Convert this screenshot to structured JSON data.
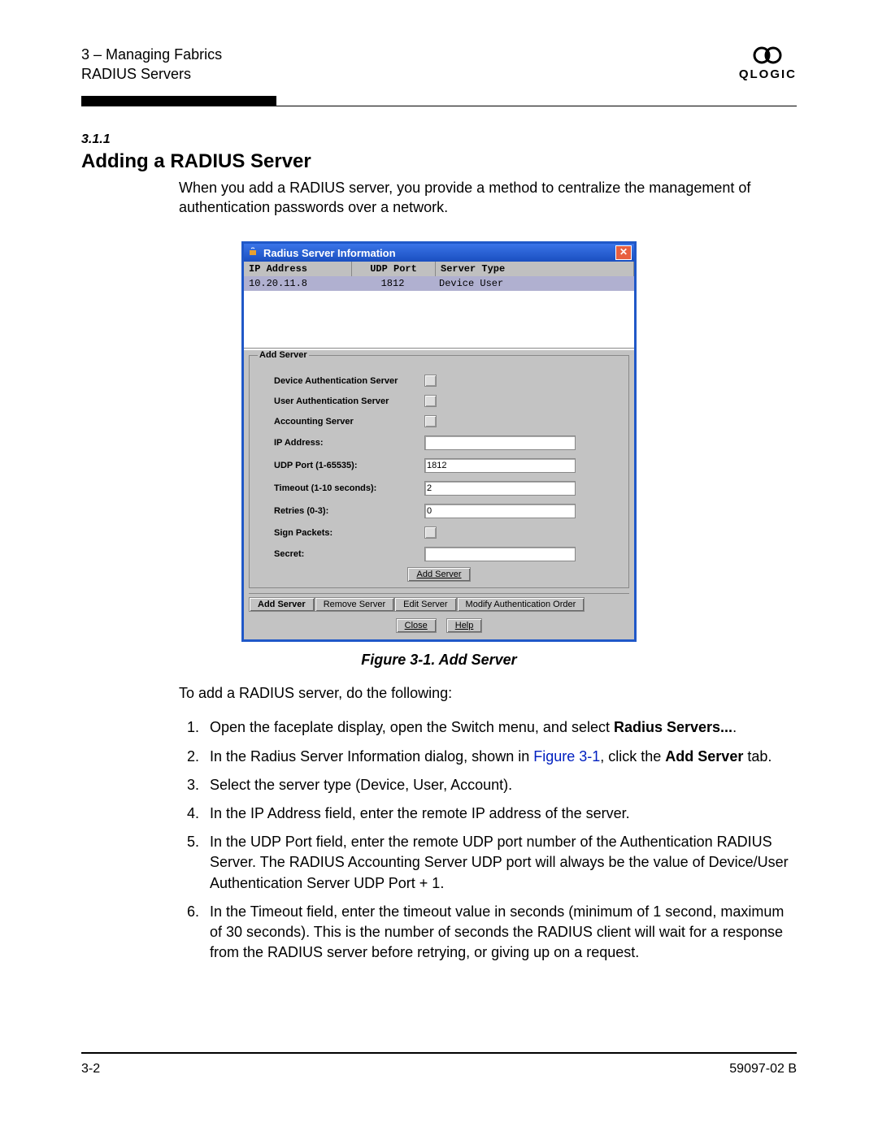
{
  "header": {
    "chapter_line": "3 – Managing Fabrics",
    "subject_line": "RADIUS Servers",
    "brand": "QLOGIC"
  },
  "section": {
    "number": "3.1.1",
    "title": "Adding a RADIUS Server",
    "intro": "When you add a RADIUS server, you provide a method to centralize the management of authentication passwords over a network."
  },
  "dialog": {
    "title": "Radius Server Information",
    "columns": {
      "ip": "IP Address",
      "port": "UDP Port",
      "type": "Server Type"
    },
    "row": {
      "ip": "10.20.11.8",
      "port": "1812",
      "type": "Device  User"
    },
    "fieldset_legend": "Add Server",
    "labels": {
      "dev_auth": "Device Authentication Server",
      "user_auth": "User Authentication Server",
      "acct": "Accounting Server",
      "ip": "IP Address:",
      "udp": "UDP Port (1-65535):",
      "timeout": "Timeout (1-10 seconds):",
      "retries": "Retries (0-3):",
      "sign": "Sign Packets:",
      "secret": "Secret:"
    },
    "values": {
      "ip": "",
      "udp": "1812",
      "timeout": "2",
      "retries": "0",
      "secret": ""
    },
    "add_button": "Add Server",
    "tabs": {
      "add": "Add Server",
      "remove": "Remove Server",
      "edit": "Edit Server",
      "modify": "Modify Authentication Order"
    },
    "close": "Close",
    "help": "Help"
  },
  "figure_caption": "Figure 3-1.  Add Server",
  "after_figure": "To add a RADIUS server, do the following:",
  "steps": {
    "s1a": "Open the faceplate display, open the Switch menu, and select ",
    "s1b": "Radius Servers...",
    "s1c": ".",
    "s2a": "In the Radius Server Information dialog, shown in ",
    "s2link": "Figure 3-1",
    "s2b": ", click the ",
    "s2c": "Add Server",
    "s2d": " tab.",
    "s3": "Select the server type (Device, User, Account).",
    "s4": "In the IP Address field, enter the remote IP address of the server.",
    "s5": "In the UDP Port field, enter the remote UDP port number of the Authentication RADIUS Server. The RADIUS Accounting Server UDP port will always be the value of Device/User Authentication Server UDP Port + 1.",
    "s6": "In the Timeout field, enter the timeout value in seconds (minimum of 1 second, maximum of 30 seconds). This is the number of seconds the RADIUS client will wait for a response from the RADIUS server before retrying, or giving up on a request."
  },
  "footer": {
    "page": "3-2",
    "doc": "59097-02 B"
  }
}
